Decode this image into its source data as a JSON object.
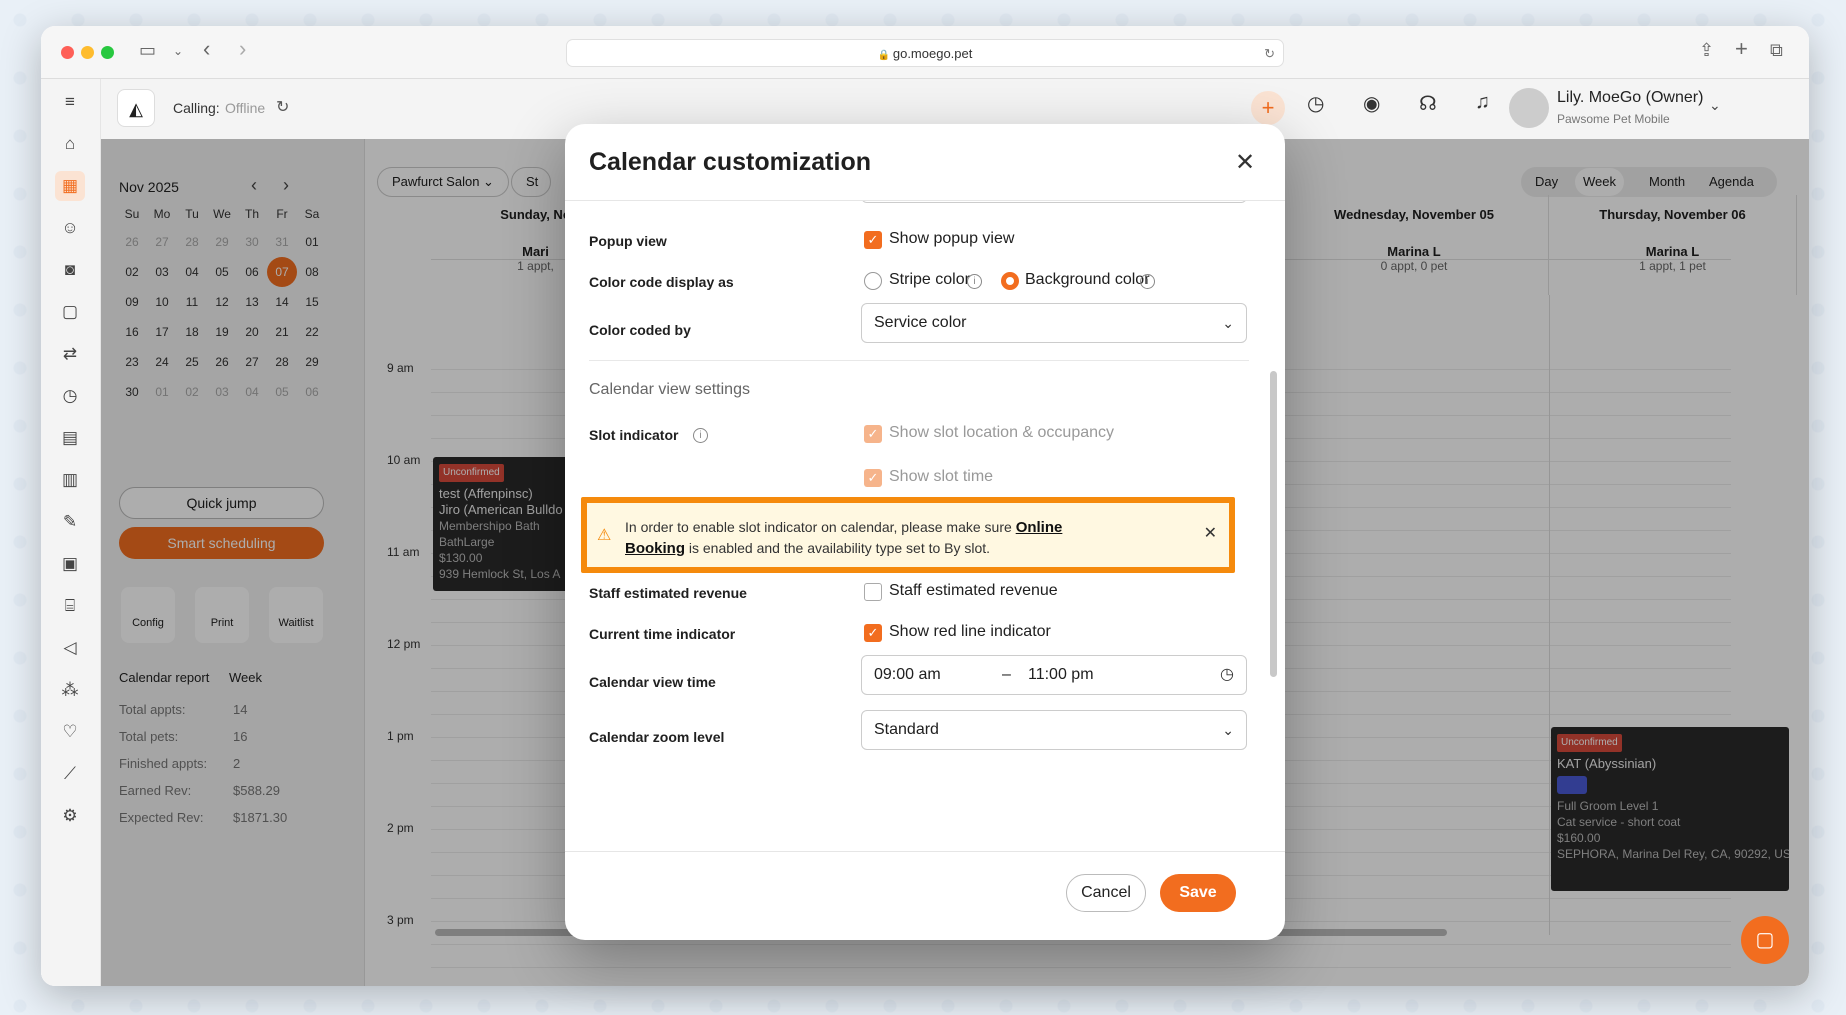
{
  "browser": {
    "url": "go.moego.pet"
  },
  "topbar": {
    "calling_label": "Calling:",
    "calling_status": "Offline",
    "user_name": "Lily. MoeGo (Owner)",
    "business_name": "Pawsome Pet Mobile"
  },
  "calendar_header": {
    "salon_select": "Pawfurct Salon",
    "partial_select": "St",
    "views": [
      "Day",
      "Week",
      "Month",
      "Agenda"
    ],
    "active_view": "Week"
  },
  "mini_calendar": {
    "month": "Nov 2025",
    "weekdays": [
      "Su",
      "Mo",
      "Tu",
      "We",
      "Th",
      "Fr",
      "Sa"
    ],
    "weeks": [
      [
        "26",
        "27",
        "28",
        "29",
        "30",
        "31",
        "01"
      ],
      [
        "02",
        "03",
        "04",
        "05",
        "06",
        "07",
        "08"
      ],
      [
        "09",
        "10",
        "11",
        "12",
        "13",
        "14",
        "15"
      ],
      [
        "16",
        "17",
        "18",
        "19",
        "20",
        "21",
        "22"
      ],
      [
        "23",
        "24",
        "25",
        "26",
        "27",
        "28",
        "29"
      ],
      [
        "30",
        "01",
        "02",
        "03",
        "04",
        "05",
        "06"
      ]
    ],
    "selected": "07"
  },
  "buttons": {
    "quick_jump": "Quick jump",
    "smart_scheduling": "Smart scheduling"
  },
  "tools": [
    "Config",
    "Print",
    "Waitlist"
  ],
  "report": {
    "title": "Calendar report",
    "period": "Week",
    "rows": [
      {
        "label": "Total appts:",
        "value": "14"
      },
      {
        "label": "Total pets:",
        "value": "16"
      },
      {
        "label": "Finished appts:",
        "value": "2"
      },
      {
        "label": "Earned Rev:",
        "value": "$588.29"
      },
      {
        "label": "Expected Rev:",
        "value": "$1871.30"
      }
    ]
  },
  "days": [
    {
      "header": "Sunday, No",
      "staff": "Mari",
      "stats": "1 appt,"
    },
    {
      "header": "Wednesday, November 05",
      "staff": "Marina L",
      "stats": "0 appt, 0 pet"
    },
    {
      "header": "Thursday, November 06",
      "staff": "Marina L",
      "stats": "1 appt, 1 pet"
    }
  ],
  "times": [
    "9 am",
    "10 am",
    "11 am",
    "12 pm",
    "1 pm",
    "2 pm",
    "3 pm"
  ],
  "appointments": [
    {
      "tag": "Unconfirmed",
      "lines": [
        "test (Affenpinsc)",
        "Jiro (American Bulldo",
        "Membershipo Bath",
        "BathLarge",
        "$130.00",
        "939 Hemlock St, Los A"
      ]
    },
    {
      "tag": "Unconfirmed",
      "lines": [
        "KAT (Abyssinian)",
        "Full Groom Level 1",
        "Cat service - short coat",
        "$160.00",
        "SEPHORA, Marina Del Rey, CA, 90292, US"
      ]
    }
  ],
  "modal": {
    "title": "Calendar customization",
    "popup_view_label": "Popup view",
    "popup_view_option": "Show popup view",
    "color_display_label": "Color code display as",
    "stripe_color": "Stripe color",
    "background_color": "Background color",
    "color_coded_by_label": "Color coded by",
    "color_coded_by_value": "Service color",
    "section_title": "Calendar view settings",
    "slot_indicator_label": "Slot indicator",
    "slot_location": "Show slot location & occupancy",
    "slot_time": "Show slot time",
    "warning_pre": "In order to enable slot indicator on calendar, please make sure ",
    "warning_link": "Online Booking",
    "warning_post": " is enabled and the availability type set to By slot.",
    "staff_revenue_label": "Staff estimated revenue",
    "staff_revenue_option": "Staff estimated revenue",
    "current_time_label": "Current time indicator",
    "current_time_option": "Show red line indicator",
    "view_time_label": "Calendar view time",
    "view_time_start": "09:00 am",
    "view_time_dash": "–",
    "view_time_end": "11:00 pm",
    "zoom_label": "Calendar zoom level",
    "zoom_value": "Standard",
    "cancel": "Cancel",
    "save": "Save"
  },
  "colors": {
    "accent": "#f26d1f",
    "warning_border": "#f58a0c",
    "warning_bg": "#fff8e1"
  }
}
